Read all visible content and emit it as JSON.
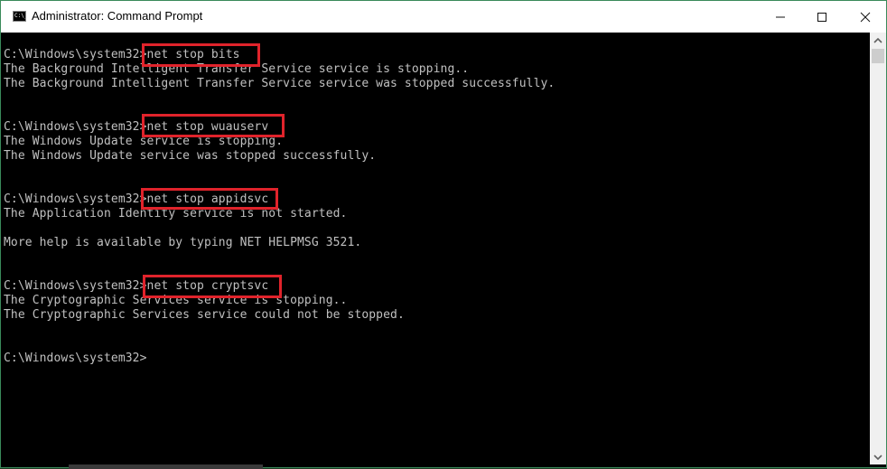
{
  "window": {
    "title": "Administrator: Command Prompt",
    "app_icon_glyph": "C:\\_",
    "controls": {
      "minimize": "—",
      "maximize": "☐",
      "close": "✕"
    }
  },
  "console": {
    "lines": [
      "C:\\Windows\\system32>net stop bits",
      "The Background Intelligent Transfer Service service is stopping..",
      "The Background Intelligent Transfer Service service was stopped successfully.",
      "",
      "",
      "C:\\Windows\\system32>net stop wuauserv",
      "The Windows Update service is stopping.",
      "The Windows Update service was stopped successfully.",
      "",
      "",
      "C:\\Windows\\system32>net stop appidsvc",
      "The Application Identity service is not started.",
      "",
      "More help is available by typing NET HELPMSG 3521.",
      "",
      "",
      "C:\\Windows\\system32>net stop cryptsvc",
      "The Cryptographic Services service is stopping..",
      "The Cryptographic Services service could not be stopped.",
      "",
      "",
      "C:\\Windows\\system32>"
    ],
    "highlighted_commands": [
      "net stop bits",
      "net stop wuauserv",
      "net stop appidsvc",
      "net stop cryptsvc"
    ],
    "highlight_color": "#e0232b",
    "text_color": "#c0c0c0",
    "background_color": "#000000"
  },
  "scrollbar": {
    "up_arrow": "⌃",
    "down_arrow": "⌄"
  }
}
